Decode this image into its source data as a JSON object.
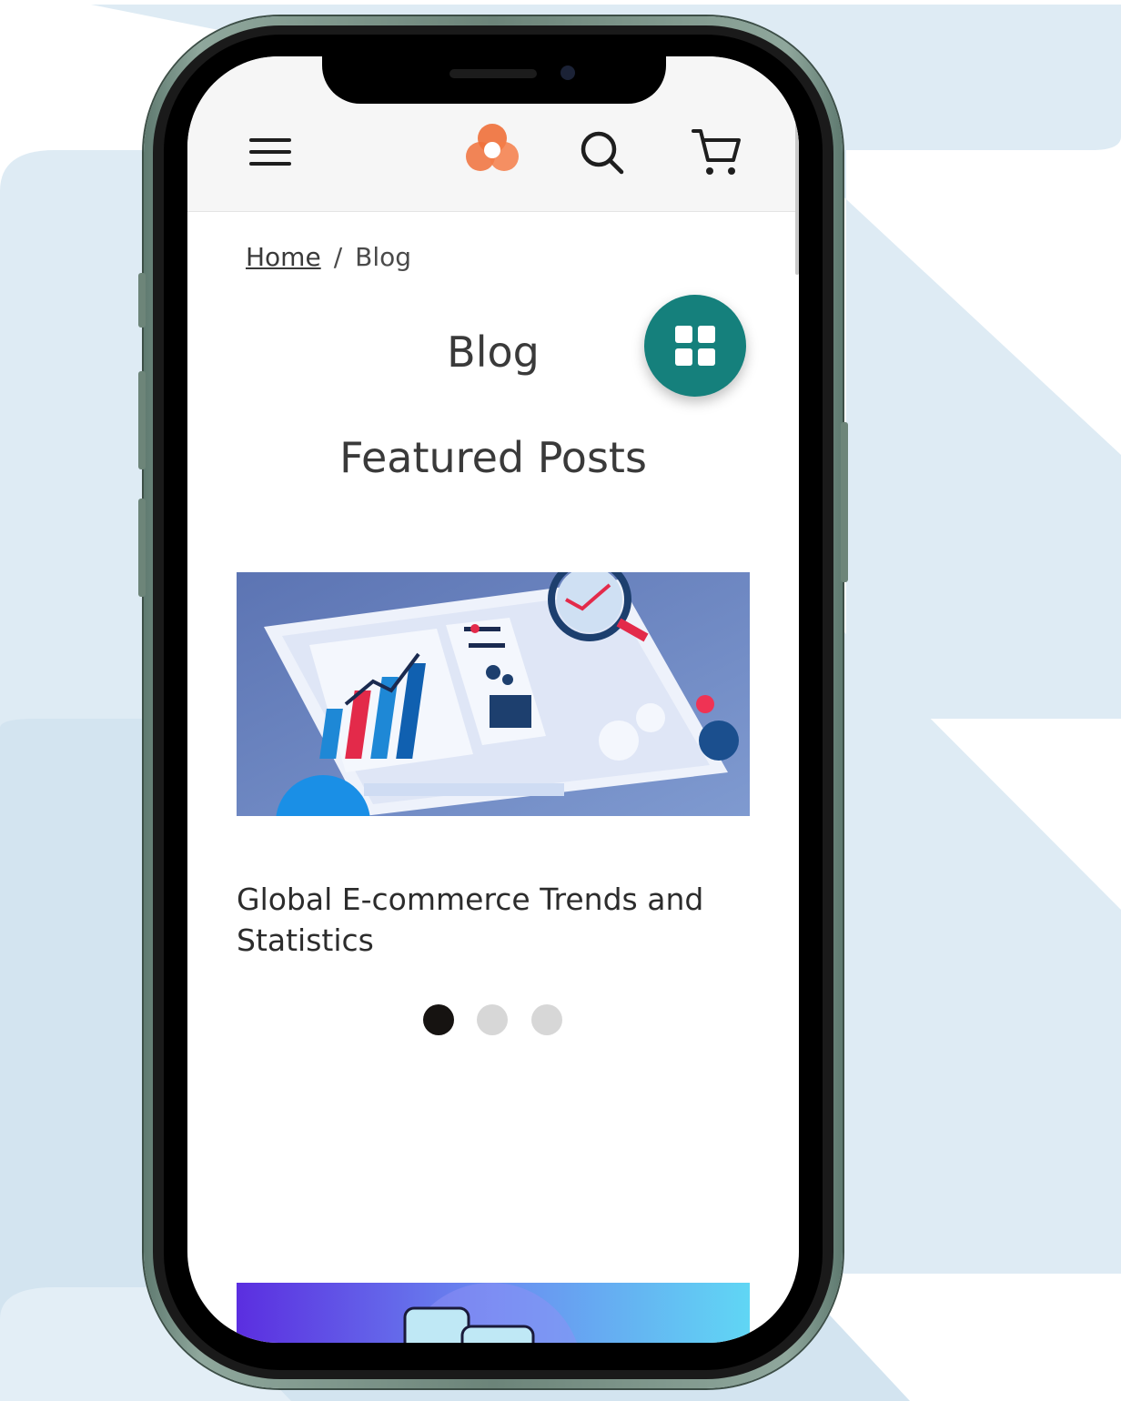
{
  "header": {
    "menu_icon": "hamburger-menu-icon",
    "logo_icon": "brand-logo-icon",
    "search_icon": "search-icon",
    "cart_icon": "cart-icon",
    "logo_color": "#f0703a"
  },
  "breadcrumb": {
    "home": "Home",
    "separator": "/",
    "current": "Blog"
  },
  "page": {
    "title": "Blog",
    "fab_icon": "grid-view-icon",
    "fab_color": "#15807c"
  },
  "featured": {
    "section_title": "Featured Posts",
    "posts": [
      {
        "title": "Global E-commerce Trends and Statistics",
        "image": "analytics-dashboard-illustration"
      }
    ],
    "carousel_total": 3,
    "carousel_active": 1
  }
}
